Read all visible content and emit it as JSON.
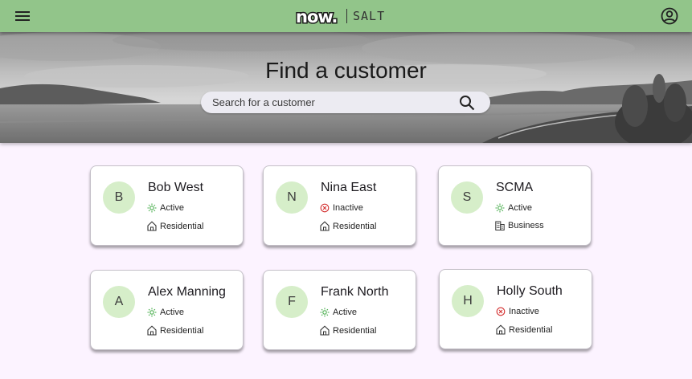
{
  "header": {
    "brand_logo_text": "now.",
    "product_name": "SALT",
    "menu_icon": "hamburger-menu-icon",
    "account_icon": "account-circle-icon"
  },
  "hero": {
    "title": "Find a customer",
    "search_placeholder": "Search for a customer",
    "search_icon": "search-icon"
  },
  "colors": {
    "topbar": "#92c58a",
    "page_background": "#fcf3ff",
    "avatar_background": "#d6eec9",
    "active_icon": "#4caf50",
    "inactive_icon": "#d32f2f"
  },
  "customers": [
    {
      "initial": "B",
      "name": "Bob West",
      "status": "Active",
      "type": "Residential"
    },
    {
      "initial": "N",
      "name": "Nina East",
      "status": "Inactive",
      "type": "Residential"
    },
    {
      "initial": "S",
      "name": "SCMA",
      "status": "Active",
      "type": "Business"
    },
    {
      "initial": "A",
      "name": "Alex Manning",
      "status": "Active",
      "type": "Residential"
    },
    {
      "initial": "F",
      "name": "Frank North",
      "status": "Active",
      "type": "Residential"
    },
    {
      "initial": "H",
      "name": "Holly South",
      "status": "Inactive",
      "type": "Residential"
    }
  ]
}
